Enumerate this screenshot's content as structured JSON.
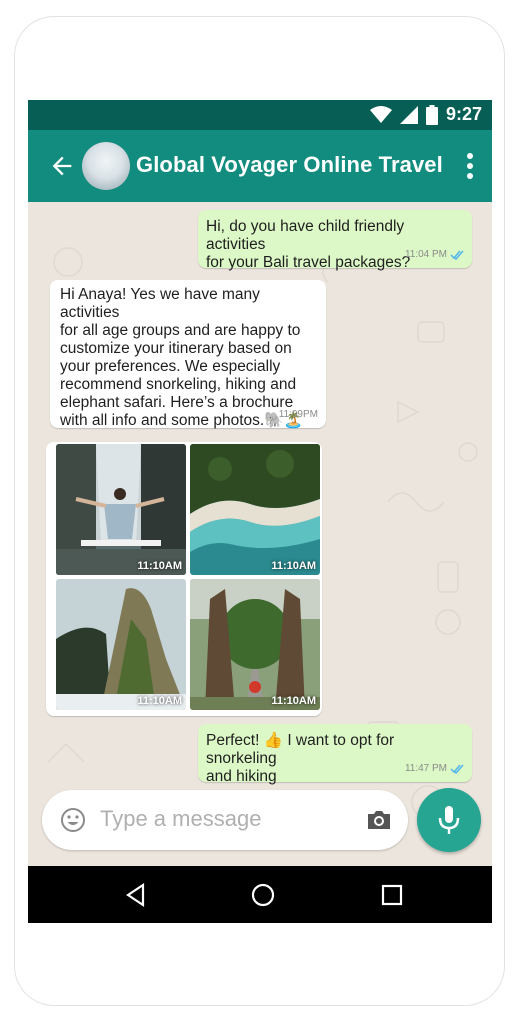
{
  "status_bar": {
    "time": "9:27"
  },
  "app_bar": {
    "title": "Global Voyager Online Travel"
  },
  "messages": [
    {
      "direction": "outgoing",
      "text": "Hi, do you have child friendly activities\nfor your Bali travel packages?",
      "time": "11:04 PM",
      "read": true
    },
    {
      "direction": "incoming",
      "text": "Hi Anaya! Yes we have many activities\nfor all age groups and are happy to\ncustomize your itinerary based on\nyour preferences. We especially\nrecommend snorkeling, hiking and\nelephant safari. Here’s a brochure\nwith all info and some photos.🐘🏝️",
      "time": "11:09PM"
    },
    {
      "direction": "outgoing",
      "text": "Perfect! 👍 I want to opt for snorkeling\nand hiking",
      "time": "11:47 PM",
      "read": true
    }
  ],
  "photos": [
    {
      "time": "11:10AM"
    },
    {
      "time": "11:10AM"
    },
    {
      "time": "11:10AM"
    },
    {
      "time": "11:10AM"
    }
  ],
  "composer": {
    "placeholder": "Type a message"
  },
  "colors": {
    "status_bar": "#075e54",
    "app_bar": "#128c7e",
    "outgoing_bubble": "#dcf8c6",
    "mic": "#25a592",
    "read_tick": "#4fb6ec"
  },
  "icons": [
    "wifi-icon",
    "signal-icon",
    "battery-icon",
    "back-arrow-icon",
    "more-vert-icon",
    "emoji-icon",
    "camera-icon",
    "mic-icon",
    "nav-back-icon",
    "nav-home-icon",
    "nav-recents-icon",
    "double-check-icon"
  ]
}
